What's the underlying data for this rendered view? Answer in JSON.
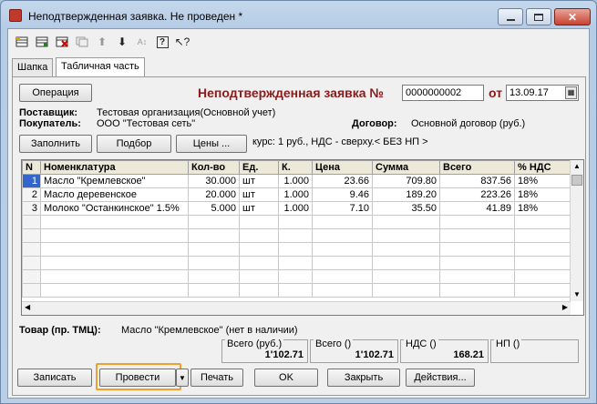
{
  "window": {
    "title": "Неподтвержденная заявка. Не проведен *",
    "accent": "#8b1a1a"
  },
  "toolbar": {
    "icons": [
      "new-row-icon",
      "add-row-icon",
      "delete-row-icon",
      "copy-row-icon",
      "move-up-icon",
      "move-down-icon",
      "sort-icon",
      "help-icon",
      "pointer-help-icon"
    ]
  },
  "tabs": [
    {
      "label": "Шапка"
    },
    {
      "label": "Табличная часть"
    }
  ],
  "header": {
    "operation_label": "Операция",
    "doc_title": "Неподтвержденная заявка №",
    "doc_number": "0000000002",
    "date_prefix": "от",
    "doc_date": "13.09.17",
    "supplier_label": "Поставщик:",
    "supplier_value": "Тестовая организация(Основной учет)",
    "buyer_label": "Покупатель:",
    "buyer_value": "ООО \"Тестовая сеть\"",
    "contract_label": "Договор:",
    "contract_value": "Основной договор (руб.)"
  },
  "actions": {
    "fill_label": "Заполнить",
    "select_label": "Подбор",
    "prices_label": "Цены ...",
    "rate_text": "курс: 1 руб., НДС - сверху.< БЕЗ НП >"
  },
  "grid": {
    "columns": [
      "N",
      "Номенклатура",
      "Кол-во",
      "Ед.",
      "К.",
      "Цена",
      "Сумма",
      "Всего",
      "% НДС"
    ],
    "rows": [
      {
        "n": "1",
        "name": "Масло \"Кремлевское\"",
        "qty": "30.000",
        "unit": "шт",
        "k": "1.000",
        "price": "23.66",
        "sum": "709.80",
        "total": "837.56",
        "vat": "18%"
      },
      {
        "n": "2",
        "name": "Масло деревенское",
        "qty": "20.000",
        "unit": "шт",
        "k": "1.000",
        "price": "9.46",
        "sum": "189.20",
        "total": "223.26",
        "vat": "18%"
      },
      {
        "n": "3",
        "name": "Молоко \"Останкинское\" 1.5%",
        "qty": "5.000",
        "unit": "шт",
        "k": "1.000",
        "price": "7.10",
        "sum": "35.50",
        "total": "41.89",
        "vat": "18%"
      }
    ],
    "selected_row": 1
  },
  "footer": {
    "goods_label": "Товар (пр. ТМЦ):",
    "goods_value": "Масло \"Кремлевское\" (нет в наличии)",
    "total_rub_label": "Всего (руб.)",
    "total_rub_value": "1'102.71",
    "total_label": "Всего ()",
    "total_value": "1'102.71",
    "vat_label": "НДС ()",
    "vat_value": "168.21",
    "np_label": "НП ()",
    "np_value": ""
  },
  "buttons": {
    "write_label": "Записать",
    "post_label": "Провести",
    "print_label": "Печать",
    "ok_label": "OK",
    "close_label": "Закрыть",
    "actions_label": "Действия..."
  }
}
